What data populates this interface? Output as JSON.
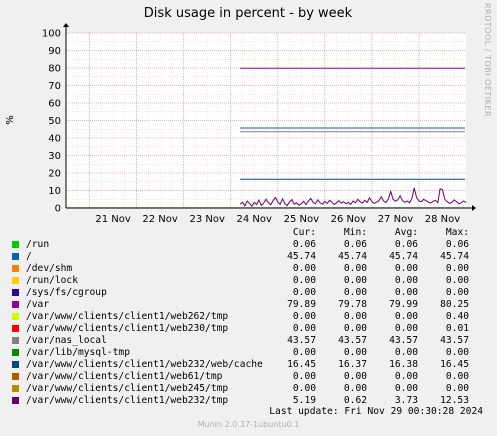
{
  "chart_data": {
    "type": "line",
    "title": "Disk usage in percent - by week",
    "ylabel": "%",
    "ylim": [
      0,
      100
    ],
    "yticks": [
      0,
      10,
      20,
      30,
      40,
      50,
      60,
      70,
      80,
      90,
      100
    ],
    "xticks": [
      "21 Nov",
      "22 Nov",
      "23 Nov",
      "24 Nov",
      "25 Nov",
      "26 Nov",
      "27 Nov",
      "28 Nov"
    ],
    "xrange_days": [
      20.5,
      29.0
    ],
    "grid": true,
    "series": [
      {
        "name": "/run",
        "color": "#00cc00",
        "start": 20.5,
        "values": [
          0.06
        ]
      },
      {
        "name": "/",
        "color": "#0066b3",
        "start": 24.2,
        "values": [
          45.74
        ]
      },
      {
        "name": "/dev/shm",
        "color": "#ff8000",
        "start": 24.2,
        "values": [
          0.0
        ]
      },
      {
        "name": "/run/lock",
        "color": "#ffcc00",
        "start": 24.2,
        "values": [
          0.0
        ]
      },
      {
        "name": "/sys/fs/cgroup",
        "color": "#330099",
        "start": 24.2,
        "values": [
          0.0
        ]
      },
      {
        "name": "/var",
        "color": "#990099",
        "start": 24.2,
        "values": [
          79.89
        ]
      },
      {
        "name": "/var/www/clients/client1/web262/tmp",
        "color": "#ccff00",
        "start": 24.2,
        "values": [
          0.0
        ]
      },
      {
        "name": "/var/www/clients/client1/web230/tmp",
        "color": "#ff0000",
        "start": 24.2,
        "values": [
          0.0
        ]
      },
      {
        "name": "/var/nas_local",
        "color": "#808080",
        "start": 24.2,
        "values": [
          43.57
        ]
      },
      {
        "name": "/var/lib/mysql-tmp",
        "color": "#008f00",
        "start": 24.2,
        "values": [
          0.0
        ]
      },
      {
        "name": "/var/www/clients/client1/web232/web/cache",
        "color": "#00487d",
        "start": 24.2,
        "values": [
          16.45
        ]
      },
      {
        "name": "/var/www/clients/client1/web61/tmp",
        "color": "#b35a00",
        "start": 24.2,
        "values": [
          0.0
        ]
      },
      {
        "name": "/var/www/clients/client1/web245/tmp",
        "color": "#b38f00",
        "start": 24.2,
        "values": [
          0.0
        ]
      },
      {
        "name": "/var/www/clients/client1/web232/tmp",
        "color": "#6b006b",
        "start": 24.2,
        "values": [
          2.1,
          3.4,
          1.2,
          4.0,
          2.5,
          1.0,
          3.2,
          2.0,
          4.5,
          1.5,
          2.8,
          5.0,
          3.0,
          1.8,
          4.2,
          6.0,
          3.5,
          2.0,
          5.2,
          2.6,
          1.4,
          3.6,
          4.8,
          2.2,
          3.0,
          1.6,
          2.4,
          3.8,
          2.0,
          4.0,
          5.5,
          3.2,
          2.4,
          4.6,
          3.0,
          2.2,
          3.8,
          2.6,
          4.4,
          3.4,
          2.0,
          3.0,
          4.2,
          2.8,
          3.6,
          2.4,
          3.2,
          2.0,
          4.0,
          3.0,
          5.0,
          3.6,
          2.8,
          4.4,
          3.2,
          5.8,
          3.6,
          2.6,
          3.4,
          4.2,
          6.4,
          4.0,
          3.2,
          5.2,
          9.5,
          5.0,
          3.8,
          4.6,
          7.0,
          4.2,
          3.2,
          4.0,
          3.0,
          5.4,
          11.5,
          6.0,
          4.0,
          3.6,
          5.0,
          4.2,
          3.4,
          2.8,
          3.8,
          4.4,
          3.0,
          11.0,
          10.5,
          5.0,
          3.6,
          2.6,
          3.2,
          4.6,
          3.6,
          2.4,
          3.0,
          4.0,
          3.2
        ]
      }
    ]
  },
  "legend": {
    "headers": [
      "Cur:",
      "Min:",
      "Avg:",
      "Max:"
    ],
    "rows": [
      {
        "label": "/run",
        "color": "#00cc00",
        "cur": "0.06",
        "min": "0.06",
        "avg": "0.06",
        "max": "0.06"
      },
      {
        "label": "/",
        "color": "#0066b3",
        "cur": "45.74",
        "min": "45.74",
        "avg": "45.74",
        "max": "45.74"
      },
      {
        "label": "/dev/shm",
        "color": "#ff8000",
        "cur": "0.00",
        "min": "0.00",
        "avg": "0.00",
        "max": "0.00"
      },
      {
        "label": "/run/lock",
        "color": "#ffcc00",
        "cur": "0.00",
        "min": "0.00",
        "avg": "0.00",
        "max": "0.00"
      },
      {
        "label": "/sys/fs/cgroup",
        "color": "#330099",
        "cur": "0.00",
        "min": "0.00",
        "avg": "0.00",
        "max": "0.00"
      },
      {
        "label": "/var",
        "color": "#990099",
        "cur": "79.89",
        "min": "79.78",
        "avg": "79.99",
        "max": "80.25"
      },
      {
        "label": "/var/www/clients/client1/web262/tmp",
        "color": "#ccff00",
        "cur": "0.00",
        "min": "0.00",
        "avg": "0.00",
        "max": "0.40"
      },
      {
        "label": "/var/www/clients/client1/web230/tmp",
        "color": "#ff0000",
        "cur": "0.00",
        "min": "0.00",
        "avg": "0.00",
        "max": "0.01"
      },
      {
        "label": "/var/nas_local",
        "color": "#808080",
        "cur": "43.57",
        "min": "43.57",
        "avg": "43.57",
        "max": "43.57"
      },
      {
        "label": "/var/lib/mysql-tmp",
        "color": "#008f00",
        "cur": "0.00",
        "min": "0.00",
        "avg": "0.00",
        "max": "0.00"
      },
      {
        "label": "/var/www/clients/client1/web232/web/cache",
        "color": "#00487d",
        "cur": "16.45",
        "min": "16.37",
        "avg": "16.38",
        "max": "16.45"
      },
      {
        "label": "/var/www/clients/client1/web61/tmp",
        "color": "#b35a00",
        "cur": "0.00",
        "min": "0.00",
        "avg": "0.00",
        "max": "0.00"
      },
      {
        "label": "/var/www/clients/client1/web245/tmp",
        "color": "#b38f00",
        "cur": "0.00",
        "min": "0.00",
        "avg": "0.00",
        "max": "0.00"
      },
      {
        "label": "/var/www/clients/client1/web232/tmp",
        "color": "#6b006b",
        "cur": "5.19",
        "min": "0.62",
        "avg": "3.73",
        "max": "12.53"
      }
    ]
  },
  "last_update": "Last update: Fri Nov 29 00:30:28 2024",
  "side_label": "RRDTOOL / TOBI OETIKER",
  "version": "Munin 2.0.37-1ubuntu0.1"
}
